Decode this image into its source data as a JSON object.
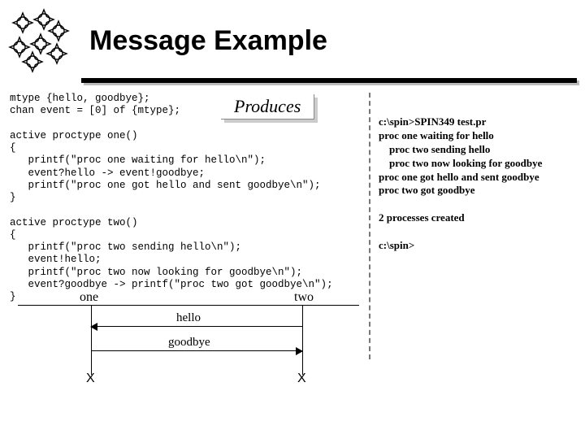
{
  "title": "Message Example",
  "produces_label": "Produces",
  "code_block1": "mtype {hello, goodbye};\nchan event = [0] of {mtype};\n\nactive proctype one()\n{\n   printf(\"proc one waiting for hello\\n\");\n   event?hello -> event!goodbye;\n   printf(\"proc one got hello and sent goodbye\\n\");\n}\n\nactive proctype two()\n{\n   printf(\"proc two sending hello\\n\");\n   event!hello;\n   printf(\"proc two now looking for goodbye\\n\");\n   event?goodbye -> printf(\"proc two got goodbye\\n\");\n}",
  "output_block": "c:\\spin>SPIN349 test.pr\nproc one waiting for hello\n    proc two sending hello\n    proc two now looking for goodbye\nproc one got hello and sent goodbye\nproc two got goodbye\n\n2 processes created\n\nc:\\spin>",
  "diagram": {
    "one": "one",
    "two": "two",
    "hello": "hello",
    "goodbye": "goodbye",
    "x": "X"
  }
}
